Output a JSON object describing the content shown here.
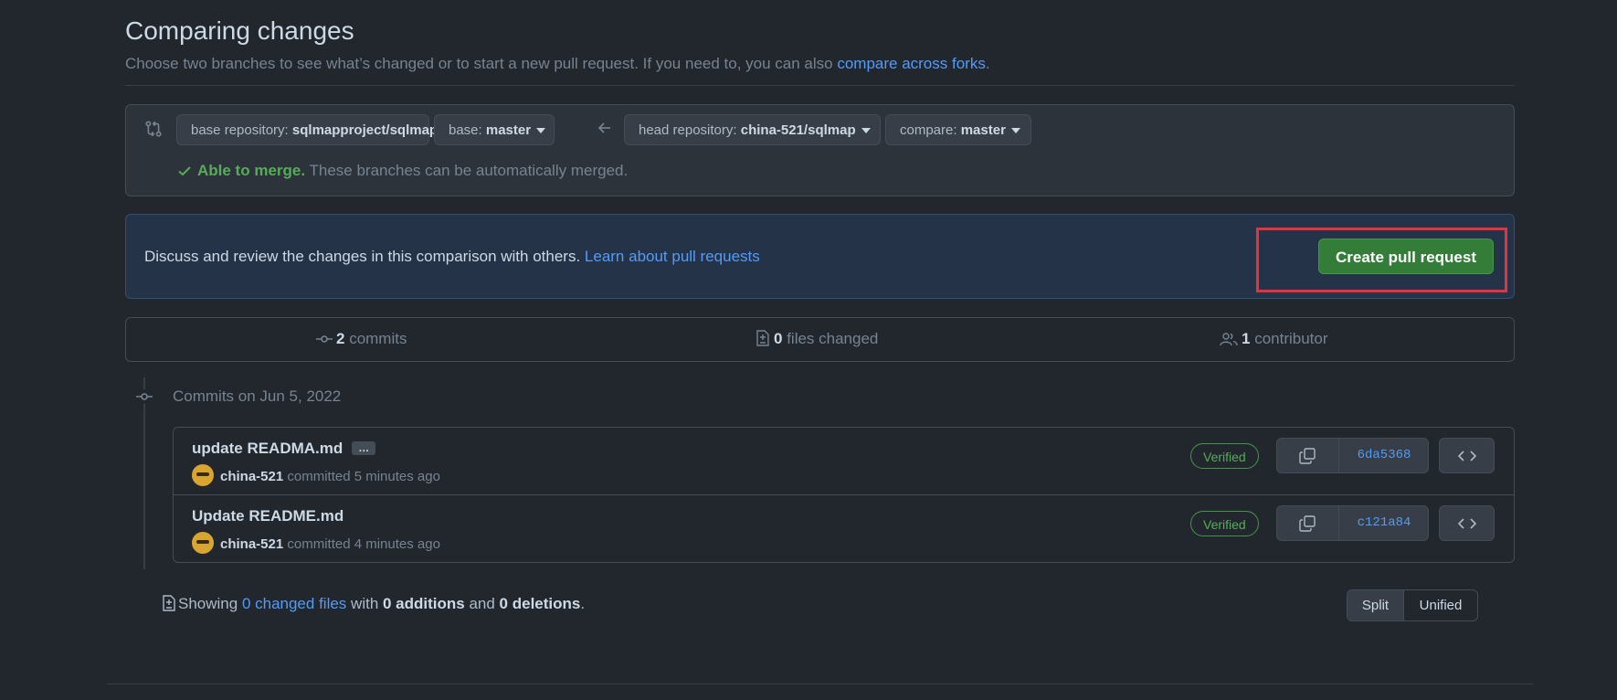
{
  "header": {
    "title": "Comparing changes",
    "subtitle": "Choose two branches to see what’s changed or to start a new pull request. If you need to, you can also ",
    "subtitle_link": "compare across forks",
    "subtitle_end": "."
  },
  "range": {
    "base_repo_label": "base repository: ",
    "base_repo_value": "sqlmapproject/sqlmap",
    "base_label": "base: ",
    "base_value": "master",
    "head_repo_label": "head repository: ",
    "head_repo_value": "china-521/sqlmap",
    "compare_label": "compare: ",
    "compare_value": "master",
    "merge_ok": "Able to merge.",
    "merge_msg": " These branches can be automatically merged."
  },
  "pr_banner": {
    "message": "Discuss and review the changes in this comparison with others. ",
    "learn_link": "Learn about pull requests",
    "create_button": "Create pull request"
  },
  "summary": {
    "commits_count": "2",
    "commits_label": " commits",
    "files_count": "0",
    "files_label": " files changed",
    "contributors_count": "1",
    "contributors_label": " contributor"
  },
  "commits_heading": "Commits on Jun 5, 2022",
  "commits": [
    {
      "title": "update READMA.md",
      "ellipsis": "…",
      "author": "china-521",
      "action": " committed 5 minutes ago",
      "verified": "Verified",
      "sha": "6da5368"
    },
    {
      "title": "Update README.md",
      "author": "china-521",
      "action": " committed 4 minutes ago",
      "verified": "Verified",
      "sha": "c121a84"
    }
  ],
  "diff": {
    "showing": "Showing ",
    "changed_files_link": "0 changed files",
    "with": " with ",
    "additions": "0 additions",
    "and": " and ",
    "deletions": "0 deletions",
    "end": ".",
    "split": "Split",
    "unified": "Unified"
  },
  "colors": {
    "accent_link": "#539bf5",
    "success": "#57ab5a",
    "create_button": "#347d39",
    "highlight": "#e5323d"
  }
}
